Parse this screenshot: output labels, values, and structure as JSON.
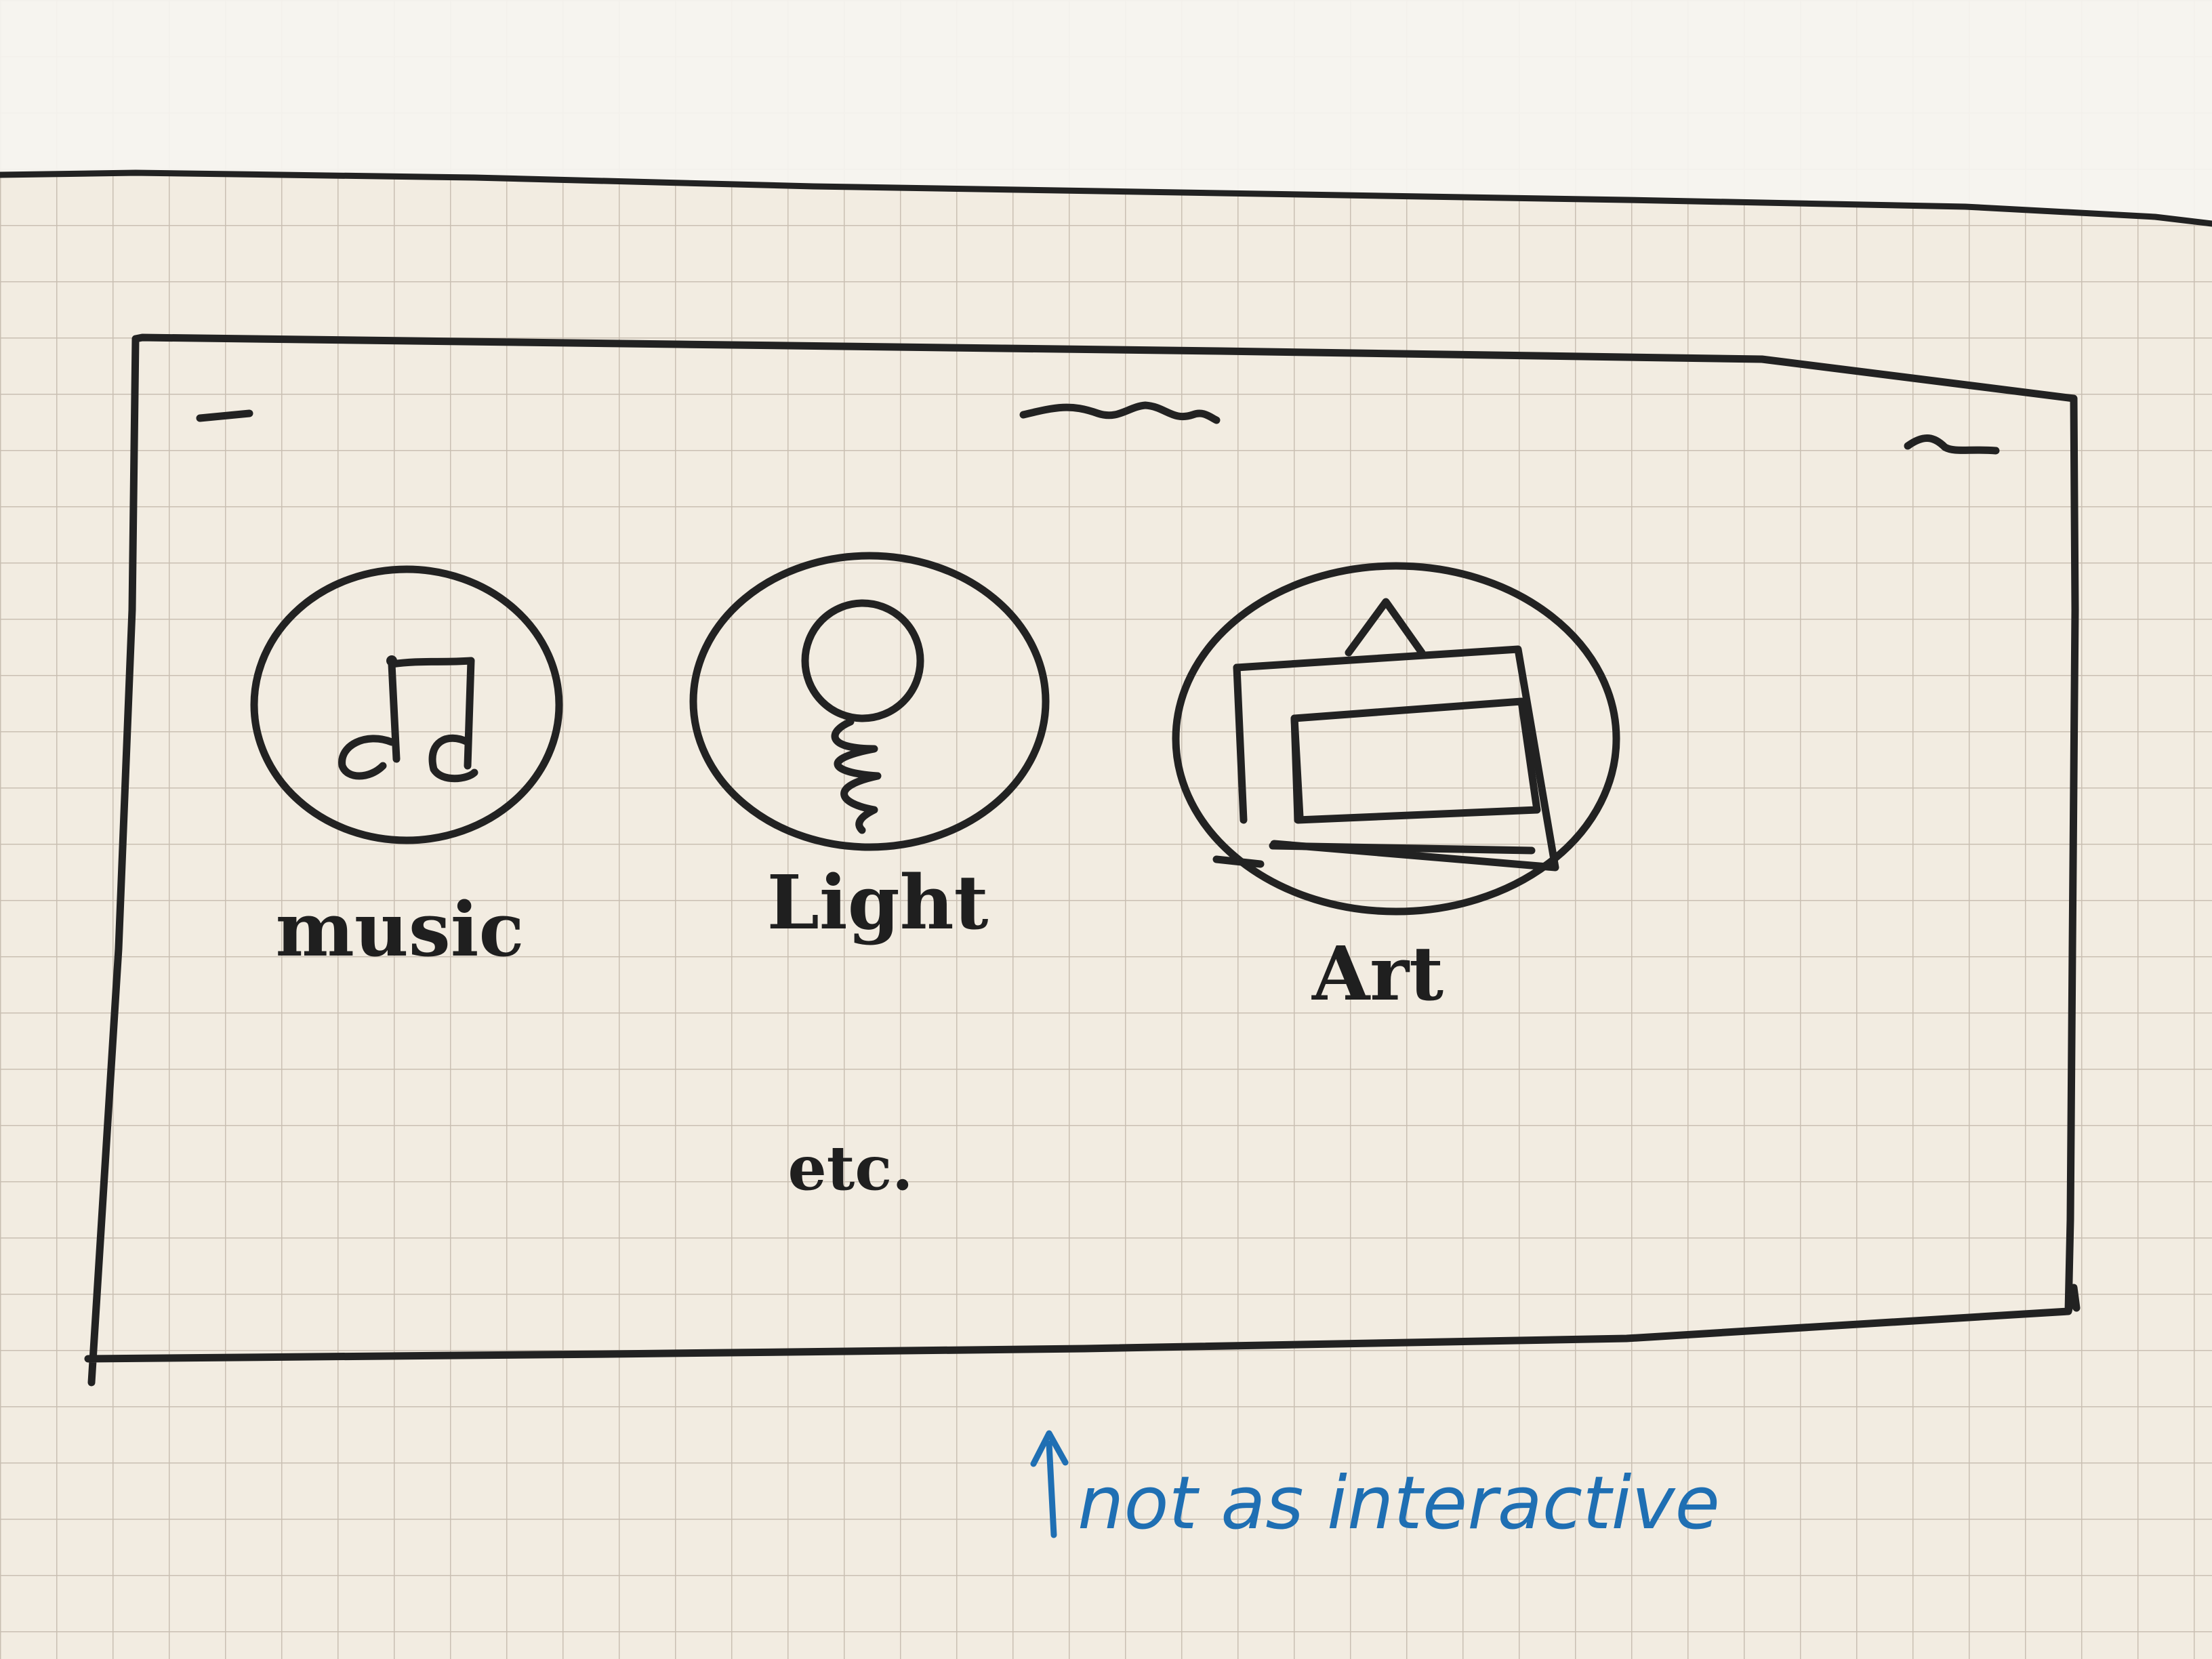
{
  "colors": {
    "paper": "#f2ece1",
    "paper_top": "#f6f4f0",
    "grid_line": "#c9bfb2",
    "ink": "#222222",
    "note_ink": "#1f6fb3"
  },
  "screen": {
    "items": [
      {
        "label": "music",
        "icon": "music-note-icon"
      },
      {
        "label": "Light",
        "icon": "light-bulb-icon"
      },
      {
        "label": "Art",
        "icon": "framed-picture-icon"
      }
    ],
    "more_label": "etc."
  },
  "annotation": {
    "text": "not as interactive",
    "arrow": "up-arrow"
  }
}
